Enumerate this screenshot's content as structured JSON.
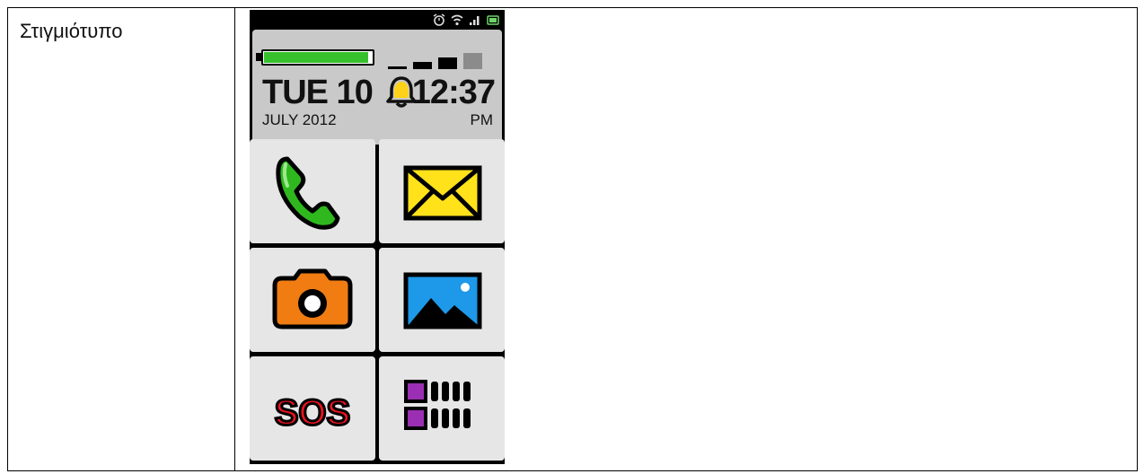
{
  "document": {
    "row_label": "Στιγμιότυπο"
  },
  "phone": {
    "widget": {
      "day": "TUE 10",
      "date": "JULY 2012",
      "time": "12:37",
      "ampm": "PM",
      "battery_level": 0.95,
      "signal_bars": 3,
      "signal_bars_total": 4
    },
    "tiles": [
      {
        "icon": "phone-icon"
      },
      {
        "icon": "envelope-icon"
      },
      {
        "icon": "camera-icon"
      },
      {
        "icon": "gallery-icon"
      },
      {
        "icon": "sos-icon",
        "label": "SOS"
      },
      {
        "icon": "apps-grid-icon"
      }
    ],
    "colors": {
      "battery": "#36c12c",
      "phone": "#2fb81e",
      "envelope": "#ffe21a",
      "camera": "#f07c12",
      "gallery": "#1e98e8",
      "sos": "#e8141e",
      "apps": "#9b2fb3"
    }
  }
}
